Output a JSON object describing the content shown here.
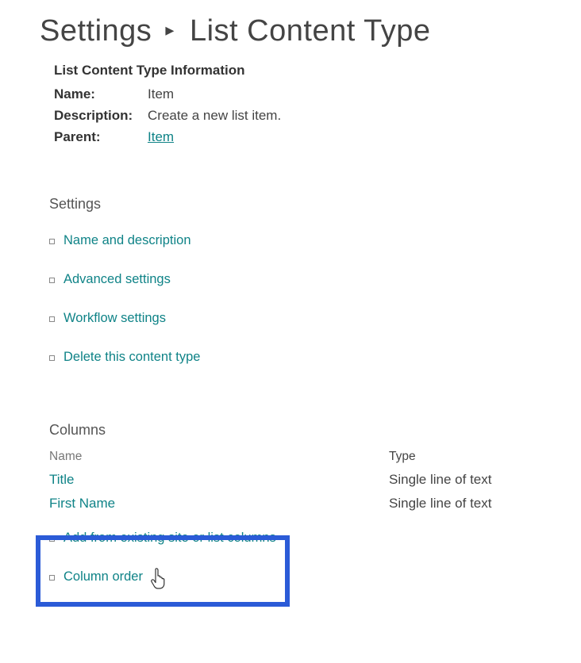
{
  "breadcrumb": {
    "parent": "Settings",
    "separator": "▸",
    "current": "List Content Type"
  },
  "info": {
    "heading": "List Content Type Information",
    "name_label": "Name:",
    "name_value": "Item",
    "description_label": "Description:",
    "description_value": "Create a new list item.",
    "parent_label": "Parent:",
    "parent_value": "Item"
  },
  "settings_section": {
    "heading": "Settings",
    "links": {
      "name_desc": "Name and description",
      "advanced": "Advanced settings",
      "workflow": "Workflow settings",
      "delete": "Delete this content type"
    }
  },
  "columns_section": {
    "heading": "Columns",
    "headers": {
      "name": "Name",
      "type": "Type"
    },
    "rows": [
      {
        "name": "Title",
        "type": "Single line of text"
      },
      {
        "name": "First Name",
        "type": "Single line of text"
      }
    ],
    "actions": {
      "add_existing": "Add from existing site or list columns",
      "column_order": "Column order"
    }
  }
}
